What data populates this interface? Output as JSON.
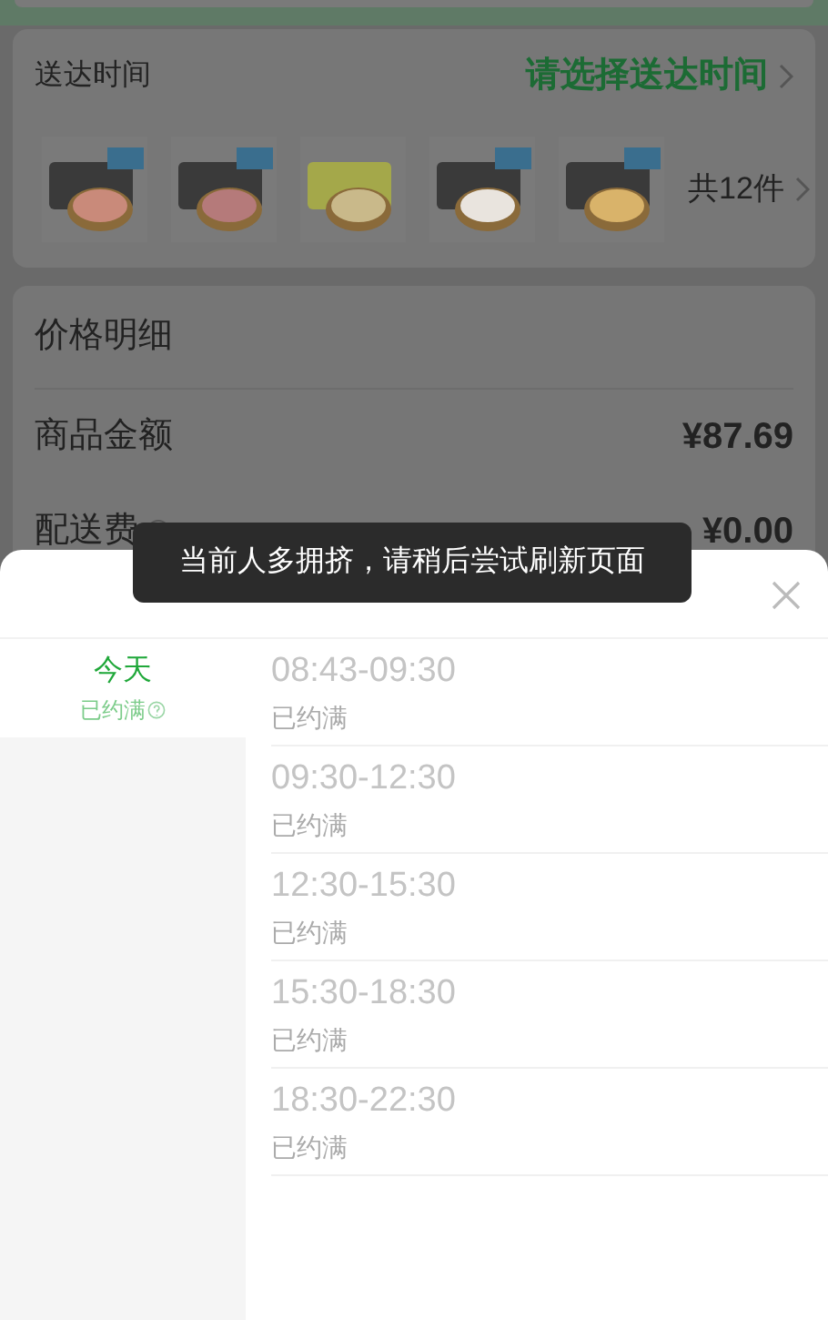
{
  "delivery_card": {
    "label": "送达时间",
    "action": "请选择送达时间",
    "count": "共12件"
  },
  "price_card": {
    "title": "价格明细",
    "rows": [
      {
        "label": "商品金额",
        "help": false,
        "price": "¥87.69"
      },
      {
        "label": "配送费",
        "help": true,
        "price": "¥0.00"
      }
    ]
  },
  "toast": "当前人多拥挤，请稍后尝试刷新页面",
  "sheet": {
    "days": [
      {
        "label": "今天",
        "status": "已约满",
        "selected": true
      }
    ],
    "slots": [
      {
        "time": "08:43-09:30",
        "status": "已约满",
        "disabled": true
      },
      {
        "time": "09:30-12:30",
        "status": "已约满",
        "disabled": true
      },
      {
        "time": "12:30-15:30",
        "status": "已约满",
        "disabled": true
      },
      {
        "time": "15:30-18:30",
        "status": "已约满",
        "disabled": true
      },
      {
        "time": "18:30-22:30",
        "status": "已约满",
        "disabled": true
      }
    ]
  }
}
